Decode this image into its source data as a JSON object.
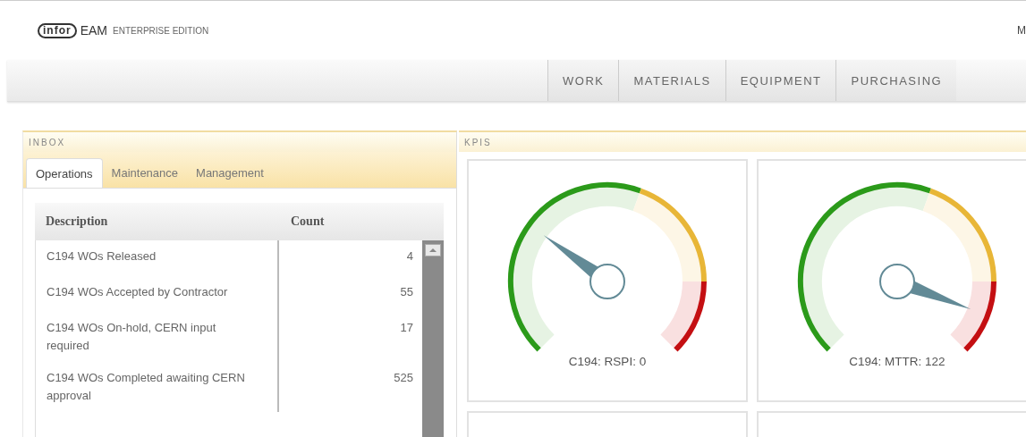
{
  "header": {
    "logo": "infor",
    "product": "EAM",
    "edition": "ENTERPRISE EDITION",
    "right_text": "M"
  },
  "nav": [
    {
      "label": "WORK"
    },
    {
      "label": "MATERIALS"
    },
    {
      "label": "EQUIPMENT"
    },
    {
      "label": "PURCHASING"
    }
  ],
  "inbox": {
    "title": "INBOX",
    "tabs": [
      {
        "label": "Operations",
        "selected": true
      },
      {
        "label": "Maintenance",
        "selected": false
      },
      {
        "label": "Management",
        "selected": false
      }
    ],
    "columns": [
      "Description",
      "Count"
    ],
    "rows": [
      {
        "description": "C194 WOs Released",
        "count": "4"
      },
      {
        "description": "C194 WOs Accepted by Contractor",
        "count": "55"
      },
      {
        "description": "C194 WOs On-hold,  CERN input required",
        "count": "17"
      },
      {
        "description": "C194 WOs Completed awaiting CERN approval",
        "count": "525"
      }
    ]
  },
  "kpis": {
    "title": "KPIS",
    "gauges": [
      {
        "label": "C194: RSPI: 0"
      },
      {
        "label": "C194: MTTR: 122"
      }
    ]
  }
}
